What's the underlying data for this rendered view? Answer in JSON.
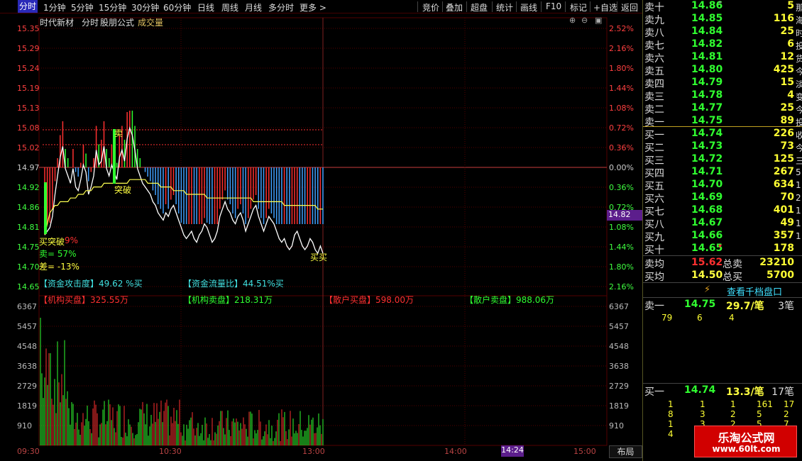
{
  "toolbar": {
    "periods": [
      "分时",
      "1分钟",
      "5分钟",
      "15分钟",
      "30分钟",
      "60分钟",
      "日线",
      "周线",
      "月线",
      "多分时",
      "更多 >"
    ],
    "tools": [
      "竞价",
      "叠加",
      "超盘",
      "统计",
      "画线",
      "F10",
      "标记",
      "+自选",
      "返回"
    ]
  },
  "chart_title": {
    "stock_name": "时代新材",
    "view_label": "分时",
    "formula_label": "股朋公式",
    "indicator_label": "成交量"
  },
  "price_axis": {
    "left": [
      "15.35",
      "15.29",
      "15.24",
      "15.19",
      "15.13",
      "15.08",
      "15.02",
      "14.97",
      "14.92",
      "14.86",
      "14.81",
      "14.75",
      "14.70",
      "14.65"
    ],
    "right": [
      "2.52%",
      "2.16%",
      "1.80%",
      "1.44%",
      "1.08%",
      "0.72%",
      "0.36%",
      "0.00%",
      "0.36%",
      "0.72%",
      "1.08%",
      "1.44%",
      "1.80%",
      "2.16%"
    ],
    "current_price": "14.82"
  },
  "volume_axis": {
    "labels": [
      "6367",
      "5457",
      "4548",
      "3638",
      "2729",
      "1819",
      "910"
    ]
  },
  "time_axis": {
    "labels": [
      "09:30",
      "10:30",
      "13:00",
      "14:00",
      "15:00"
    ],
    "cursor_time": "14:24",
    "layout_button": "布局"
  },
  "signals": {
    "sell1": "卖",
    "breakout1": "突破",
    "buy_breakout": "买突破",
    "sell_pct": "卖= 57%",
    "buy_pct": "9%",
    "diff_pct": "差= -13%",
    "buy_buy": "买买"
  },
  "capital_flow": {
    "attack": "【资金攻击度】49.62 %买",
    "flow_ratio": "【资金流量比】44.51%买",
    "inst_buy": "【机构买盘】325.55万",
    "inst_sell": "【机构卖盘】218.31万",
    "retail_buy": "【散户买盘】598.00万",
    "retail_sell": "【散户卖盘】988.06万"
  },
  "order_book": {
    "asks": [
      {
        "label": "卖十",
        "price": "14.86",
        "vol": "5",
        "marker": "*"
      },
      {
        "label": "卖九",
        "price": "14.85",
        "vol": "116"
      },
      {
        "label": "卖八",
        "price": "14.84",
        "vol": "25"
      },
      {
        "label": "卖七",
        "price": "14.82",
        "vol": "6"
      },
      {
        "label": "卖六",
        "price": "14.81",
        "vol": "12"
      },
      {
        "label": "卖五",
        "price": "14.80",
        "vol": "425"
      },
      {
        "label": "卖四",
        "price": "14.79",
        "vol": "15"
      },
      {
        "label": "卖三",
        "price": "14.78",
        "vol": "4"
      },
      {
        "label": "卖二",
        "price": "14.77",
        "vol": "25"
      },
      {
        "label": "卖一",
        "price": "14.75",
        "vol": "89"
      }
    ],
    "bids": [
      {
        "label": "买一",
        "price": "14.74",
        "vol": "226"
      },
      {
        "label": "买二",
        "price": "14.73",
        "vol": "73"
      },
      {
        "label": "买三",
        "price": "14.72",
        "vol": "125"
      },
      {
        "label": "买四",
        "price": "14.71",
        "vol": "267"
      },
      {
        "label": "买五",
        "price": "14.70",
        "vol": "634"
      },
      {
        "label": "买六",
        "price": "14.69",
        "vol": "70"
      },
      {
        "label": "买七",
        "price": "14.68",
        "vol": "401"
      },
      {
        "label": "买八",
        "price": "14.67",
        "vol": "49"
      },
      {
        "label": "买九",
        "price": "14.66",
        "vol": "357"
      },
      {
        "label": "买十",
        "price": "14.65",
        "vol": "178",
        "marker": "▾"
      }
    ],
    "avg_sell_label": "卖均",
    "avg_sell": "15.62",
    "total_sell_label": "总卖",
    "total_sell": "23210",
    "avg_buy_label": "买均",
    "avg_buy": "14.50",
    "total_buy_label": "总买",
    "total_buy": "5700",
    "thousand_level_button": "查看千档盘口"
  },
  "queue": {
    "sell_label": "卖一",
    "sell_price": "14.75",
    "sell_avg": "29.7/笔",
    "sell_count": "3笔",
    "sell_orders": [
      "79",
      "6",
      "4"
    ],
    "buy_label": "买一",
    "buy_price": "14.74",
    "buy_avg": "13.3/笔",
    "buy_count": "17笔",
    "buy_orders": [
      [
        "1",
        "1",
        "1",
        "161",
        "17"
      ],
      [
        "8",
        "3",
        "2",
        "5",
        "2"
      ],
      [
        "1",
        "3",
        "2",
        "5",
        "7"
      ],
      [
        "4"
      ]
    ]
  },
  "side_strip": [
    "那",
    "海",
    "时",
    "投",
    "货",
    "今",
    "淡",
    "变",
    "今",
    "投",
    "收",
    "今",
    "三",
    "5",
    "1",
    "2",
    "1",
    "1",
    "1"
  ],
  "watermark": {
    "title": "乐淘公式网",
    "url": "www.60lt.com"
  },
  "colors": {
    "up": "#ff3030",
    "down": "#30ff30",
    "price_line": "#ffffff",
    "avg_line": "#ffff50",
    "grid": "#550000",
    "accent": "#3d2bb5",
    "text_yellow": "#ffff40",
    "flow_cyan": "#40e0e0"
  },
  "chart_data": {
    "type": "line",
    "series": [
      {
        "values": [
          14.79,
          14.8,
          14.81,
          14.84,
          14.9,
          14.95,
          15.0,
          15.03,
          14.97,
          14.95,
          14.93,
          14.97,
          14.92,
          14.91,
          14.94,
          14.98,
          14.96,
          14.9,
          14.92,
          14.95,
          15.02,
          14.98,
          14.99,
          15.03,
          14.97,
          14.95,
          14.98,
          14.96,
          14.94,
          15.0,
          15.02,
          14.99,
          15.05,
          15.08,
          15.06,
          15.02,
          14.97,
          14.95,
          14.93,
          14.92,
          14.91,
          14.9,
          14.88,
          14.87,
          14.85,
          14.84,
          14.83,
          14.85,
          14.84,
          14.86,
          14.87,
          14.85,
          14.83,
          14.81,
          14.79,
          14.78,
          14.79,
          14.8,
          14.78,
          14.77,
          14.79,
          14.8,
          14.82,
          14.81,
          14.79,
          14.77,
          14.78,
          14.8,
          14.84,
          14.86,
          14.88,
          14.86,
          14.85,
          14.83,
          14.82,
          14.84,
          14.85,
          14.83,
          14.8,
          14.82,
          14.84,
          14.86,
          14.87,
          14.84,
          14.82,
          14.8,
          14.82,
          14.84,
          14.83,
          14.82,
          14.8,
          14.78,
          14.77,
          14.78,
          14.76,
          14.75,
          14.76,
          14.79,
          14.8,
          14.78,
          14.76,
          14.75,
          14.76,
          14.78,
          14.77,
          14.75,
          14.74,
          14.76,
          14.74
        ]
      },
      {
        "values": [
          14.79,
          14.82,
          14.85,
          14.86,
          14.87,
          14.87,
          14.88,
          14.88,
          14.88,
          14.88,
          14.89,
          14.89,
          14.89,
          14.9,
          14.9,
          14.9,
          14.91,
          14.91,
          14.91,
          14.92,
          14.92,
          14.92,
          14.92,
          14.93,
          14.93,
          14.93,
          14.93,
          14.93,
          14.93,
          14.93,
          14.93,
          14.93,
          14.93,
          14.94,
          14.94,
          14.94,
          14.94,
          14.94,
          14.94,
          14.94,
          14.93,
          14.93,
          14.93,
          14.93,
          14.93,
          14.92,
          14.92,
          14.92,
          14.92,
          14.92,
          14.91,
          14.91,
          14.91,
          14.91,
          14.91,
          14.9,
          14.9,
          14.9,
          14.9,
          14.9,
          14.9,
          14.9,
          14.9,
          14.89,
          14.89,
          14.89,
          14.89,
          14.89,
          14.89,
          14.89,
          14.89,
          14.89,
          14.89,
          14.89,
          14.89,
          14.89,
          14.89,
          14.89,
          14.89,
          14.89,
          14.89,
          14.88,
          14.88,
          14.88,
          14.88,
          14.88,
          14.88,
          14.88,
          14.88,
          14.88,
          14.88,
          14.88,
          14.88,
          14.87,
          14.87,
          14.87,
          14.87,
          14.87,
          14.87,
          14.87,
          14.87,
          14.87,
          14.87,
          14.87,
          14.87,
          14.87,
          14.86,
          14.86,
          14.86
        ]
      }
    ],
    "ylim": [
      14.62,
      15.36
    ]
  }
}
